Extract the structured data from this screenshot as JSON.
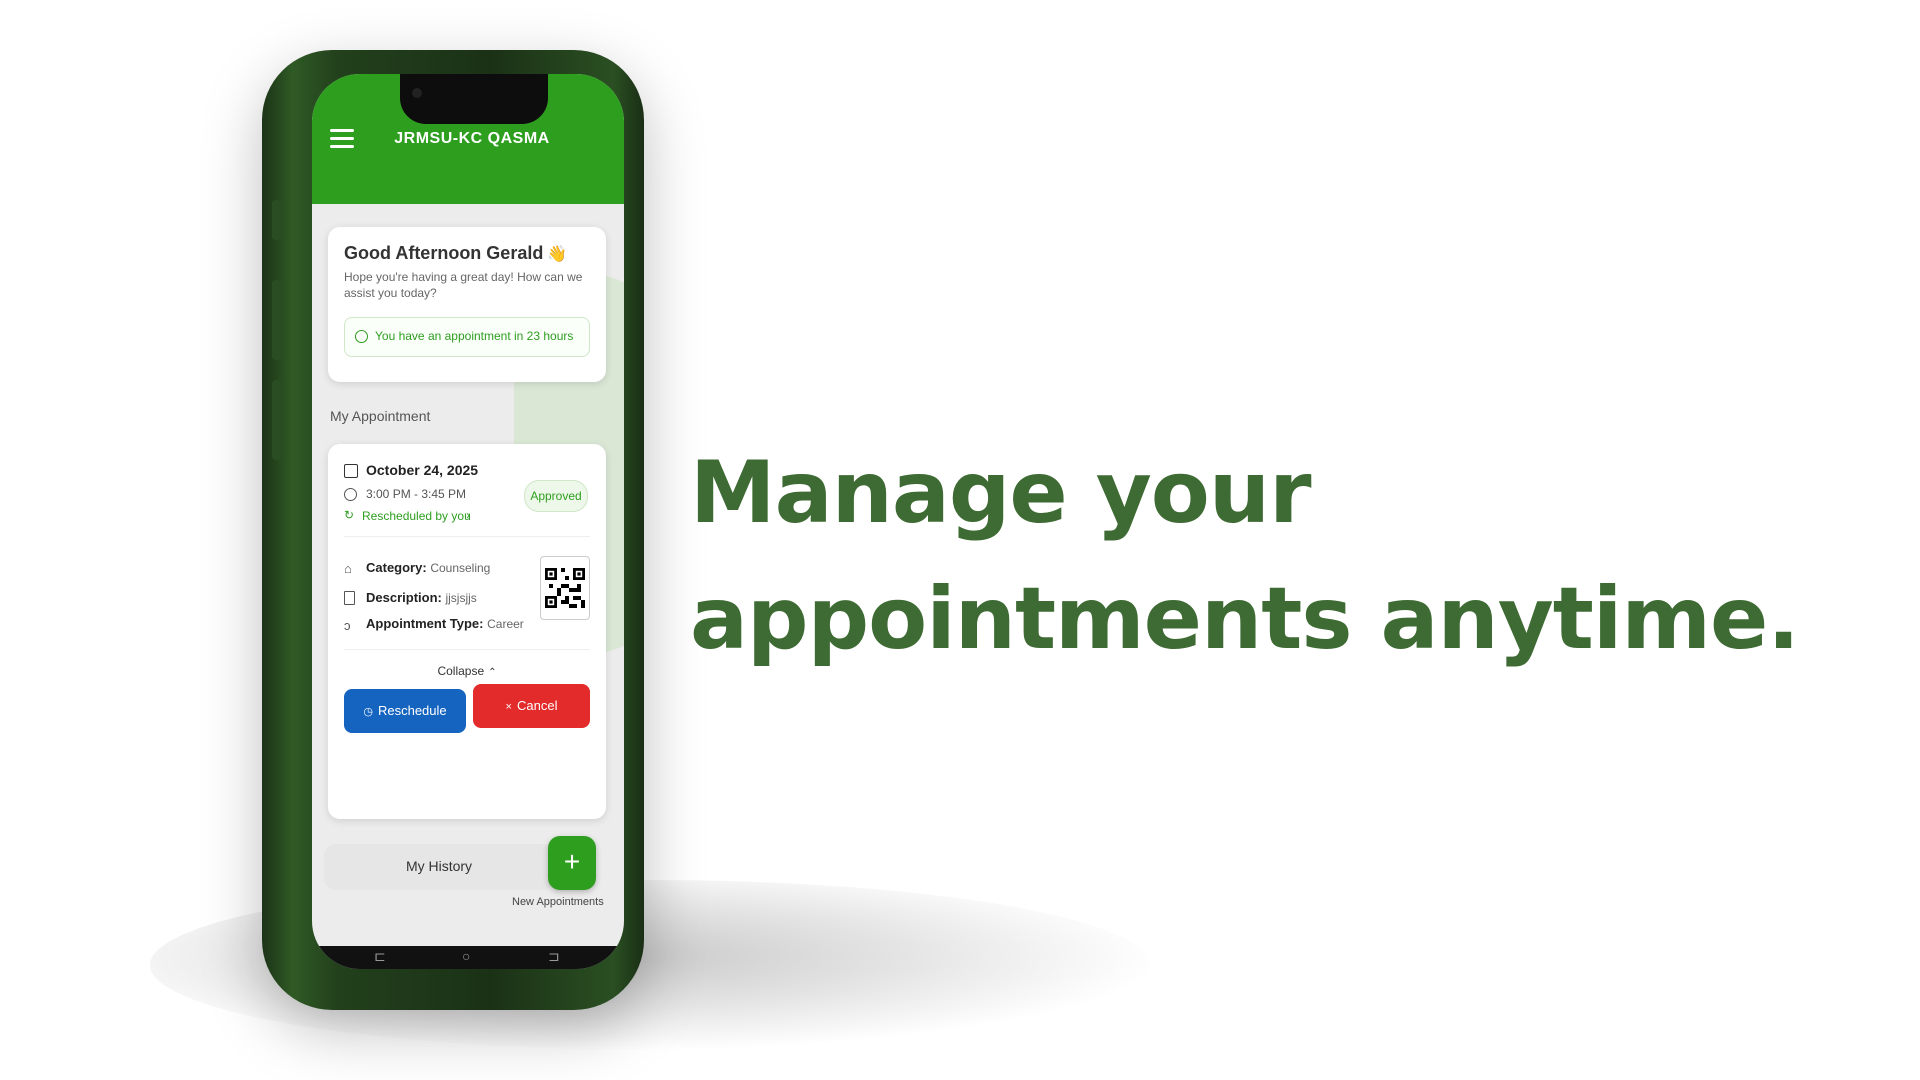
{
  "app": {
    "title": "JRMSU-KC QASMA"
  },
  "greeting": {
    "title": "Good Afternoon Gerald",
    "wave_emoji": "👋",
    "subtitle": "Hope you're having a great day! How can we assist you today?",
    "notice": "You have an appointment in 23 hours"
  },
  "section": {
    "my_appointment": "My Appointment"
  },
  "appointment": {
    "date": "October 24, 2025",
    "time": "3:00 PM - 3:45 PM",
    "rescheduled": "Rescheduled by you",
    "status": "Approved",
    "category_label": "Category:",
    "category_value": "Counseling",
    "description_label": "Description:",
    "description_value": "jjsjsjjs",
    "type_label": "Appointment Type:",
    "type_value": "Career",
    "collapse": "Collapse",
    "reschedule_button": "Reschedule",
    "cancel_button": "Cancel"
  },
  "bottom": {
    "history": "My History",
    "fab_symbol": "+",
    "fab_label": "New Appointments"
  },
  "headline": {
    "line1": "Manage your",
    "line2": "appointments anytime."
  },
  "colors": {
    "primary_green": "#2e9e1f",
    "reschedule_blue": "#1565c0",
    "cancel_red": "#e32b2b",
    "headline_green": "#3e6b33"
  }
}
